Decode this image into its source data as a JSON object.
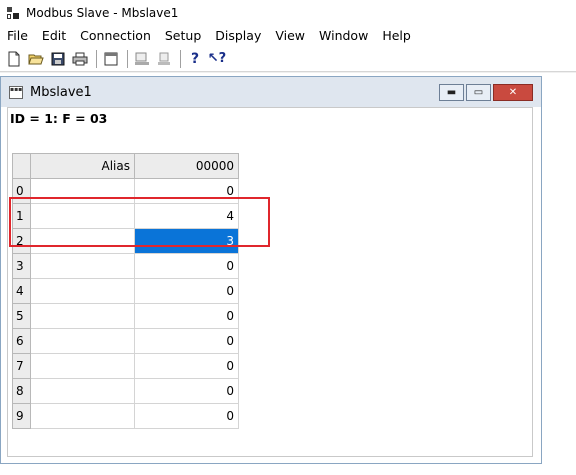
{
  "app": {
    "title": "Modbus Slave - Mbslave1",
    "icon": "modbus-app-icon"
  },
  "menu": [
    "File",
    "Edit",
    "Connection",
    "Setup",
    "Display",
    "View",
    "Window",
    "Help"
  ],
  "toolbar": {
    "buttons": [
      "new-icon",
      "open-icon",
      "save-icon",
      "print-icon",
      "window-icon",
      "register-icon",
      "register-alt-icon",
      "help-icon",
      "context-help-icon"
    ]
  },
  "child": {
    "title": "Mbslave1",
    "minimize": "▬",
    "restore": "▭",
    "close": "✕",
    "id_line": "ID = 1: F = 03"
  },
  "grid": {
    "headers": {
      "alias": "Alias",
      "value": "00000"
    },
    "rows": [
      {
        "index": "0",
        "alias": "",
        "value": "0"
      },
      {
        "index": "1",
        "alias": "",
        "value": "4"
      },
      {
        "index": "2",
        "alias": "",
        "value": "3"
      },
      {
        "index": "3",
        "alias": "",
        "value": "0"
      },
      {
        "index": "4",
        "alias": "",
        "value": "0"
      },
      {
        "index": "5",
        "alias": "",
        "value": "0"
      },
      {
        "index": "6",
        "alias": "",
        "value": "0"
      },
      {
        "index": "7",
        "alias": "",
        "value": "0"
      },
      {
        "index": "8",
        "alias": "",
        "value": "0"
      },
      {
        "index": "9",
        "alias": "",
        "value": "0"
      }
    ],
    "selected_row": 2,
    "selected_color": "#0a74d8",
    "highlight_color": "#e0262c"
  }
}
